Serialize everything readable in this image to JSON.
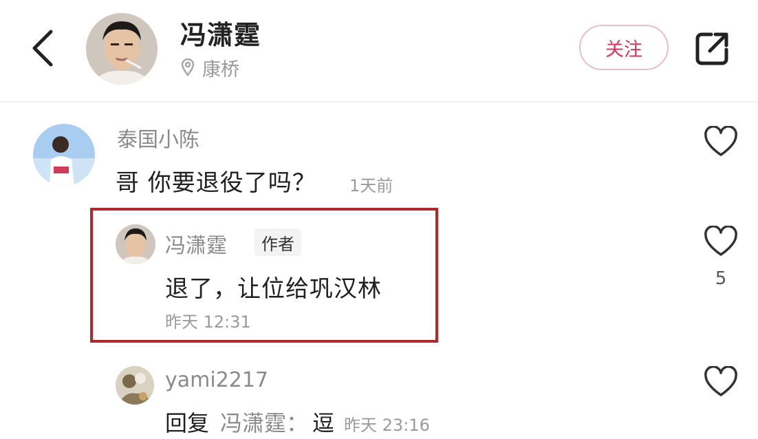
{
  "header": {
    "name": "冯潇霆",
    "location": "康桥",
    "follow_label": "关注"
  },
  "comments": [
    {
      "user": "泰国小陈",
      "text": "哥 你要退役了吗？",
      "time": "1天前"
    },
    {
      "user": "冯潇霆",
      "badge": "作者",
      "text": "退了，让位给巩汉林",
      "time": "昨天 12:31",
      "likes": "5"
    },
    {
      "user": "yami2217",
      "reply_prefix": "回复",
      "reply_target": "冯潇霆：",
      "text": "逗",
      "time": "昨天 23:16"
    }
  ],
  "colors": {
    "accent": "#e0345c",
    "highlight_border": "#b0282e",
    "muted_text": "#8a8a8a"
  },
  "icons": {
    "back": "chevron-left-icon",
    "location": "map-pin-icon",
    "share": "share-icon",
    "like": "heart-icon"
  }
}
